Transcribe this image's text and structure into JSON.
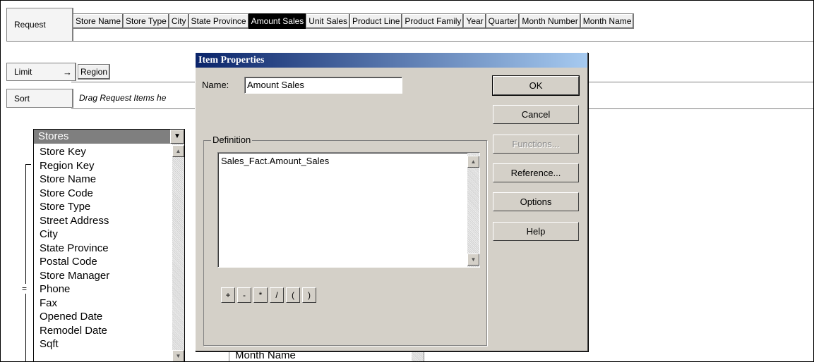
{
  "request": {
    "label": "Request",
    "items": [
      "Store Name",
      "Store Type",
      "City",
      "State Province",
      "Amount Sales",
      "Unit Sales",
      "Product Line",
      "Product Family",
      "Year",
      "Quarter",
      "Month Number",
      "Month Name"
    ],
    "selected_index": 4
  },
  "limit": {
    "label": "Limit",
    "arrow": "→",
    "items": [
      "Region"
    ]
  },
  "sort": {
    "label": "Sort",
    "placeholder": "Drag Request Items he"
  },
  "equals_marker": "=",
  "stores_list": {
    "title": "Stores",
    "items": [
      "Store Key",
      "Region Key",
      "Store Name",
      "Store Code",
      "Store Type",
      "Street Address",
      "City",
      "State Province",
      "Postal Code",
      "Store Manager",
      "Phone",
      "Fax",
      "Opened Date",
      "Remodel Date",
      "Sqft"
    ]
  },
  "bottom_list": {
    "partial_item": "Month Name"
  },
  "dialog": {
    "title": "Item Properties",
    "name_label": "Name:",
    "name_value": "Amount Sales",
    "definition_label": "Definition",
    "definition_text": "Sales_Fact.Amount_Sales",
    "buttons": {
      "ok": "OK",
      "cancel": "Cancel",
      "functions": "Functions...",
      "reference": "Reference...",
      "options": "Options",
      "help": "Help"
    },
    "operators": [
      "+",
      "-",
      "*",
      "/",
      "(",
      ")"
    ]
  },
  "colors": {
    "title_start": "#0a246a",
    "title_end": "#a6caf0",
    "dialog_bg": "#d4d0c8",
    "selected_chip": "#000000"
  },
  "icons": {
    "limit_arrow": "right-arrow-icon",
    "dropdown": "chevron-down-icon",
    "scroll_up": "scroll-up-icon",
    "scroll_down": "scroll-down-icon"
  }
}
